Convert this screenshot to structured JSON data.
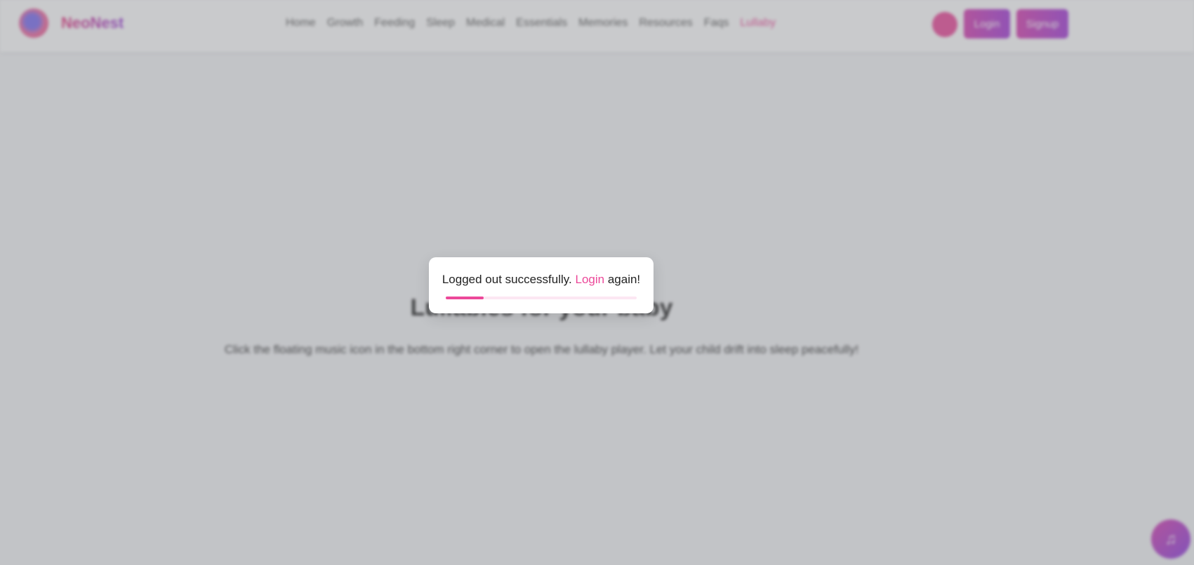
{
  "nav": {
    "brand": "NeoNest",
    "links": [
      {
        "label": "Home",
        "active": false
      },
      {
        "label": "Growth",
        "active": false
      },
      {
        "label": "Feeding",
        "active": false
      },
      {
        "label": "Sleep",
        "active": false
      },
      {
        "label": "Medical",
        "active": false
      },
      {
        "label": "Essentials",
        "active": false
      },
      {
        "label": "Memories",
        "active": false
      },
      {
        "label": "Resources",
        "active": false
      },
      {
        "label": "Faqs",
        "active": false
      },
      {
        "label": "Lullaby",
        "active": true
      }
    ],
    "login_label": "Login",
    "signup_label": "Signup"
  },
  "hero": {
    "title": "Lullabies for your baby",
    "subtitle": "Click the floating music icon in the bottom right corner to open the lullaby player. Let your child drift into sleep peacefully!"
  },
  "toast": {
    "message_prefix": "Logged out successfully.",
    "link_text": "Login",
    "message_suffix": "again!",
    "progress": 0.2
  },
  "colors": {
    "accent": "#ec4899",
    "accent_light": "#fce7f3",
    "gradient_start": "#d63cb0",
    "gradient_end": "#a33ad8"
  },
  "icons": {
    "logo": "baby-logo-icon",
    "profile": "circle-icon",
    "fab": "music-note-icon"
  }
}
